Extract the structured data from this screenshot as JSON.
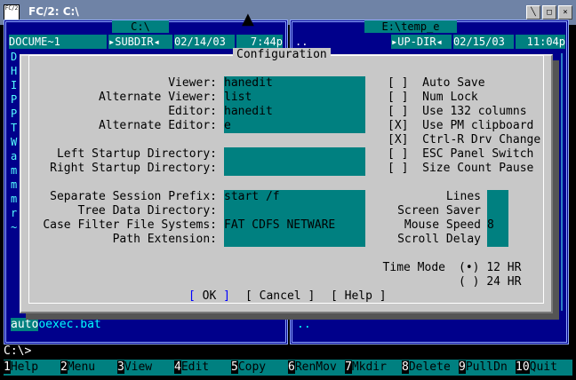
{
  "window": {
    "title": "FC/2: C:\\",
    "icon_text": "FC/2",
    "minimize_glyph": "╲",
    "restore_glyph": "□",
    "close_glyph": "×",
    "cursor_glyph": "▲"
  },
  "left_panel": {
    "path": "C:\\",
    "name_header": "DOCUME~1",
    "dir_label": "▸SUBDIR◂",
    "date": "02/14/03",
    "time": "7:44p",
    "visible_chars": [
      "D",
      "H",
      "I",
      "P",
      "P",
      "T",
      "W",
      "a",
      "m",
      "m",
      "m",
      "r",
      "~"
    ],
    "footer_selected": "auto",
    "footer_rest": "oexec.bat"
  },
  "right_panel": {
    "path": "E:\\temp_e",
    "name_header": "..",
    "dir_label": "▸UP-DIR◂",
    "date": "02/15/03",
    "time": "11:04p",
    "footer": ".."
  },
  "dialog": {
    "title": "Configuration",
    "fields": {
      "viewer": {
        "label": "Viewer:",
        "value": "hanedit"
      },
      "alt_viewer": {
        "label": "Alternate Viewer:",
        "value": "list"
      },
      "editor": {
        "label": "Editor:",
        "value": "hanedit"
      },
      "alt_editor": {
        "label": "Alternate Editor:",
        "value": "e"
      },
      "left_startup": {
        "label": "Left Startup Directory:",
        "value": ""
      },
      "right_startup": {
        "label": "Right Startup Directory:",
        "value": ""
      },
      "session_prefix": {
        "label": "Separate Session Prefix:",
        "value": "start /f"
      },
      "tree_dir": {
        "label": "Tree Data Directory:",
        "value": ""
      },
      "case_filter": {
        "label": "Case Filter File Systems:",
        "value": "FAT CDFS NETWARE"
      },
      "path_ext": {
        "label": "Path Extension:",
        "value": ""
      }
    },
    "checkboxes": [
      {
        "mark": "[ ]",
        "label": "Auto Save"
      },
      {
        "mark": "[ ]",
        "label": "Num Lock"
      },
      {
        "mark": "[ ]",
        "label": "Use 132 columns"
      },
      {
        "mark": "[X]",
        "label": "Use PM clipboard"
      },
      {
        "mark": "[X]",
        "label": "Ctrl-R Drv Change"
      },
      {
        "mark": "[ ]",
        "label": "ESC Panel Switch"
      },
      {
        "mark": "[ ]",
        "label": "Size Count Pause"
      }
    ],
    "numbers": [
      {
        "label": "Lines",
        "value": ""
      },
      {
        "label": "Screen Saver",
        "value": ""
      },
      {
        "label": "Mouse Speed",
        "value": "8"
      },
      {
        "label": "Scroll Delay",
        "value": ""
      }
    ],
    "time_mode": {
      "label": "Time Mode",
      "options": [
        {
          "mark": "(•)",
          "label": "12 HR"
        },
        {
          "mark": "( )",
          "label": "24 HR"
        }
      ]
    },
    "buttons": {
      "ok": "OK",
      "cancel": "Cancel",
      "help": "Help"
    }
  },
  "command_line": "C:\\>",
  "function_keys": [
    {
      "num": "1",
      "label": "Help"
    },
    {
      "num": "2",
      "label": "Menu"
    },
    {
      "num": "3",
      "label": "View"
    },
    {
      "num": "4",
      "label": "Edit"
    },
    {
      "num": "5",
      "label": "Copy"
    },
    {
      "num": "6",
      "label": "RenMov"
    },
    {
      "num": "7",
      "label": "Mkdir"
    },
    {
      "num": "8",
      "label": "Delete"
    },
    {
      "num": "9",
      "label": "PullDn"
    },
    {
      "num": "10",
      "label": "Quit"
    }
  ]
}
